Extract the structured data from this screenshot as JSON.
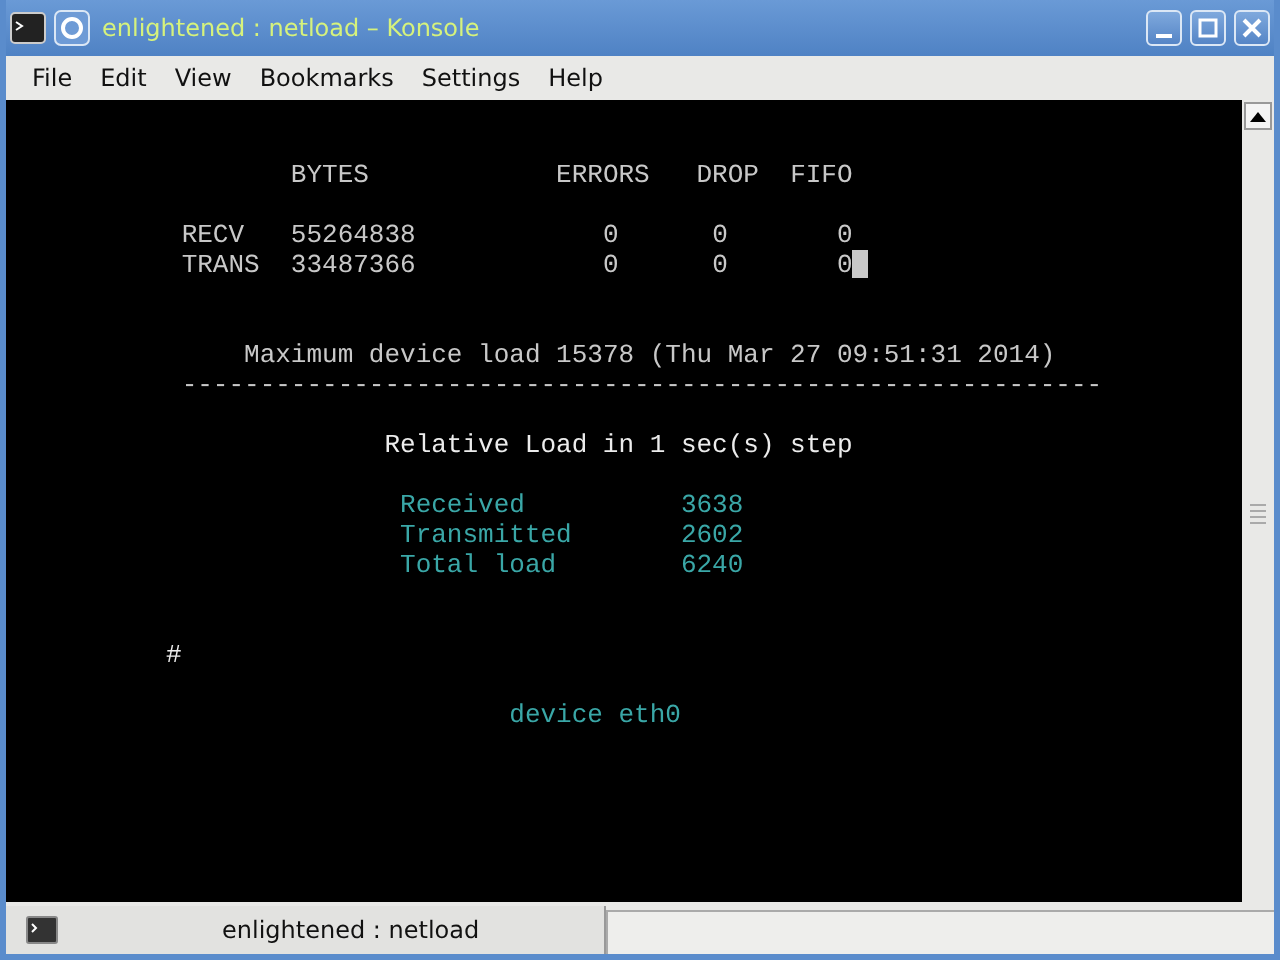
{
  "window": {
    "title": "enlightened : netload – Konsole"
  },
  "menu": [
    "File",
    "Edit",
    "View",
    "Bookmarks",
    "Settings",
    "Help"
  ],
  "terminal": {
    "columns": [
      "BYTES",
      "ERRORS",
      "DROP",
      "FIFO"
    ],
    "rows": [
      {
        "label": "RECV",
        "bytes": "55264838",
        "errors": "0",
        "drop": "0",
        "fifo": "0"
      },
      {
        "label": "TRANS",
        "bytes": "33487366",
        "errors": "0",
        "drop": "0",
        "fifo": "0"
      }
    ],
    "max_load": "Maximum device load 15378 (Thu Mar 27 09:51:31 2014)",
    "separator": "-----------------------------------------------------------",
    "relative_title": "Relative Load in 1 sec(s) step",
    "stats": [
      {
        "label": "Received",
        "value": "3638"
      },
      {
        "label": "Transmitted",
        "value": "2602"
      },
      {
        "label": "Total load",
        "value": "6240"
      }
    ],
    "prompt": "#",
    "device": "device eth0"
  },
  "tabs": [
    {
      "label": "enlightened : netload",
      "selected": true
    }
  ]
}
